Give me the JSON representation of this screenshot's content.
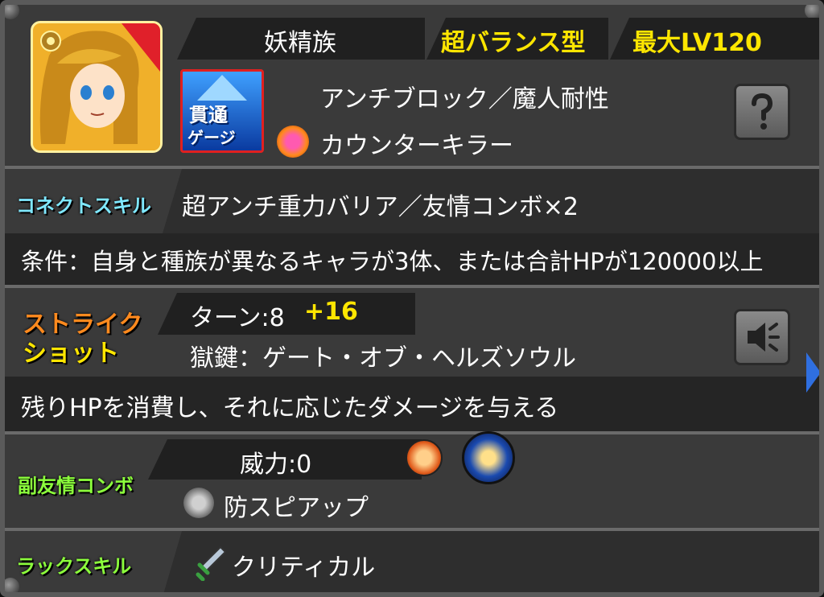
{
  "header": {
    "race": "妖精族",
    "type": "超バランス型",
    "max_level": "最大LV120",
    "ability_main": "アンチブロック／魔人耐性",
    "ability_gauge": "カウンターキラー",
    "gauge_badge_line1": "貫通",
    "gauge_badge_amp": "&",
    "gauge_badge_line2": "ゲージ"
  },
  "connect": {
    "label": "コネクトスキル",
    "skill": "超アンチ重力バリア／友情コンボ×2",
    "condition": "条件：自身と種族が異なるキャラが3体、または合計HPが120000以上"
  },
  "strike": {
    "label_line1": "ストライク",
    "label_line2": "ショット",
    "turns": "ターン:8",
    "turns_plus": "+16",
    "name": "獄鍵：ゲート・オブ・ヘルズソウル",
    "description": "残りHPを消費し、それに応じたダメージを与える"
  },
  "sub_friend": {
    "label": "副友情コンボ",
    "power": "威力:0",
    "name": "防スピアップ"
  },
  "luck": {
    "label": "ラックスキル",
    "name": "クリティカル"
  },
  "colors": {
    "yellow": "#ffe600",
    "cyan": "#7fe8ff",
    "orange": "#ff8a1e",
    "green": "#8cff3c"
  },
  "icons": {
    "help": "question-icon",
    "sound": "speaker-icon",
    "next": "arrow-right-icon"
  }
}
